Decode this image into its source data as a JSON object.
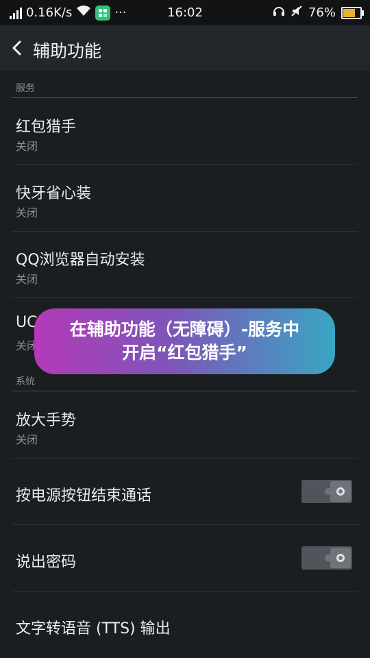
{
  "status_bar": {
    "net_speed": "0.16K/s",
    "time": "16:02",
    "battery": "76%",
    "battery_level": 0.76,
    "more": "···"
  },
  "header": {
    "title": "辅助功能"
  },
  "sections": {
    "services": {
      "header": "服务",
      "items": [
        {
          "title": "红包猎手",
          "status": "关闭"
        },
        {
          "title": "快牙省心装",
          "status": "关闭"
        },
        {
          "title": "QQ浏览器自动安装",
          "status": "关闭"
        },
        {
          "title": "UC",
          "status": "关闭"
        }
      ]
    },
    "system": {
      "header": "系统",
      "items": [
        {
          "title": "放大手势",
          "status": "关闭"
        },
        {
          "title": "按电源按钮结束通话",
          "toggle": false
        },
        {
          "title": "说出密码",
          "toggle": false
        },
        {
          "title": "文字转语音 (TTS) 输出"
        }
      ]
    }
  },
  "toast": {
    "line1": "在辅助功能（无障碍）-服务中",
    "line2": "开启“红包猎手”"
  },
  "colors": {
    "toast_gradient_start": "#b33ab8",
    "toast_gradient_end": "#3aa6c3",
    "background": "#1b1e21"
  }
}
